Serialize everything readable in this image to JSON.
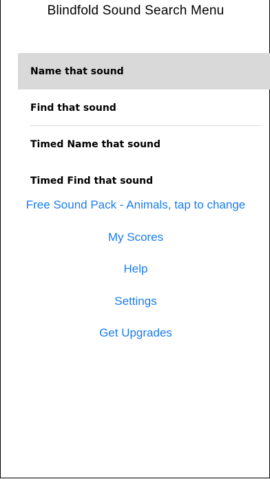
{
  "header": {
    "title": "Blindfold Sound Search Menu"
  },
  "menu": {
    "items": [
      {
        "label": "Name that sound",
        "selected": true
      },
      {
        "label": "Find that sound",
        "selected": false
      },
      {
        "label": "Timed Name that sound",
        "selected": false
      },
      {
        "label": "Timed Find that sound",
        "selected": false
      }
    ]
  },
  "links": {
    "sound_pack": "Free Sound Pack - Animals, tap to change",
    "my_scores": "My Scores",
    "help": "Help",
    "settings": "Settings",
    "get_upgrades": "Get Upgrades"
  },
  "colors": {
    "link": "#1a7cf0",
    "selected_row": "#d9d9d9"
  }
}
